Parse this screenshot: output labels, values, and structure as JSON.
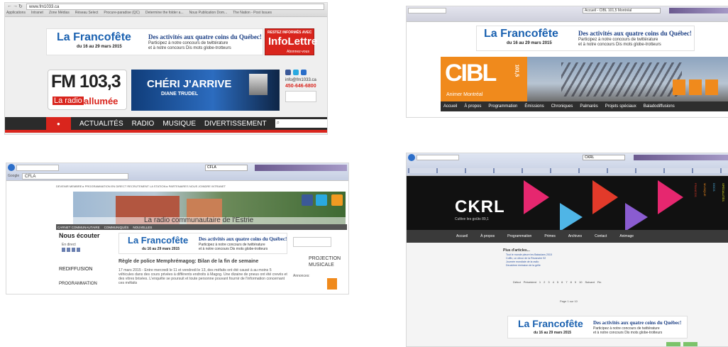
{
  "banner": {
    "brand": "La Francofête",
    "dates": "du 16 au 29 mars 2015",
    "headline": "Des activités aux quatre coins du Québec!",
    "sub1": "Participez à notre concours de twittérature",
    "sub2": "et à notre concours Dis mots globe-trotteurs"
  },
  "fm1033": {
    "url": "www.fm1033.ca",
    "bookmarks": [
      "Applications",
      "Intranet",
      "Zone Médias",
      "Réseau Select",
      "Procure-paradise (QC)",
      "Determine the folder a...",
      "Nous Publication Dom...",
      "The Nation - Post Issues"
    ],
    "promo_top": "RESTEZ INFORMÉS AVEC",
    "promo_main": "InfoLettre",
    "promo_sub": "Abonnez-vous",
    "logo_freq": "FM 103,3",
    "logo_tag_a": "La radio",
    "logo_tag_b": "allumée",
    "ad_main": "CHÉRI J'ARRIVE",
    "ad_artist": "DIANE TRUDEL",
    "contact_email": "info@fm1033.ca",
    "contact_phone": "450-646-6800",
    "nav": [
      "ACTUALITÉS",
      "RADIO",
      "MUSIQUE",
      "DIVERTISSEMENT"
    ]
  },
  "cibl": {
    "title_tab": "Accueil - CIBL 101,5 Montréal",
    "logo": "CIBL",
    "logo_freq": "101,5",
    "tagline": "Animer Montréal",
    "nav": [
      "Accueil",
      "À propos",
      "Programmation",
      "Émissions",
      "Chroniques",
      "Palmarès",
      "Projets spéciaux",
      "Baladodiffusions"
    ]
  },
  "cfla": {
    "search_label": "Google",
    "search_value": "CFLA",
    "tab_title": "CFLA",
    "top_links": "DEVENIR MEMBRE ▸  PROGRAMMATION  EN DIRECT  RECRUTEMENT  LA STATION ▸  PARTENAIRES  NOUS JOINDRE  INTRANET",
    "caption": "La radio communautaire de l'Estrie",
    "sub_nav": [
      "CARNET COMMUNAUTAIRE",
      "COMMUNIQUÉS",
      "NOUVELLES"
    ],
    "listen_title": "Nous écouter",
    "live_label": "En direct",
    "replay_label": "REDIFFUSION",
    "prog_label": "PROGRAMMATION",
    "article_title": "Règle de police Memphrémagog: Bilan de la fin de semaine",
    "article_text": "17 mars 2015 - Entre mercredi le 11 et vendredi le 13, des méfaits ont été causé à au moins 5 véhicules dans des cours privées à différents endroits à Magog. Une dizaine de pneus ont été crevés et des vitres brisées. L'enquête se poursuit et toute personne pouvant fournir de l'information concernant ces méfaits",
    "projection_a": "PROJECTION",
    "projection_b": "MUSICALE",
    "annonces": "Annonces:"
  },
  "ckrl": {
    "tab_title": "CKRL",
    "logo": "CKRL",
    "logo_sub": "Cultive les goûts 89,1",
    "side_labels": [
      "FRANCOS",
      "MUSIQUE",
      "DOCS",
      "SPÉCIALITÉS"
    ],
    "nav": [
      "Accueil",
      "À propos",
      "Programmation",
      "Primes",
      "Archives",
      "Contact",
      "Animage"
    ],
    "more_title": "Plus d'articles...",
    "more_items": [
      "Tout le monde pleure les Bataclans 2015",
      "Coffin, un décor de la Revanche 92",
      "Journée mondiale de la radio",
      "Deuxième émission de la grille"
    ],
    "pagination": [
      "Début",
      "Précédent",
      "1",
      "2",
      "3",
      "4",
      "5",
      "6",
      "7",
      "8",
      "9",
      "10",
      "Suivant",
      "Fin"
    ],
    "page_of": "Page 1 sur 10"
  },
  "colors": {
    "fm_red": "#d9251d",
    "dark_nav": "#3a3a3a",
    "cibl_orange": "#f08a1c",
    "ckrl_pink": "#e6276f",
    "francofete_blue": "#1a61b0"
  }
}
